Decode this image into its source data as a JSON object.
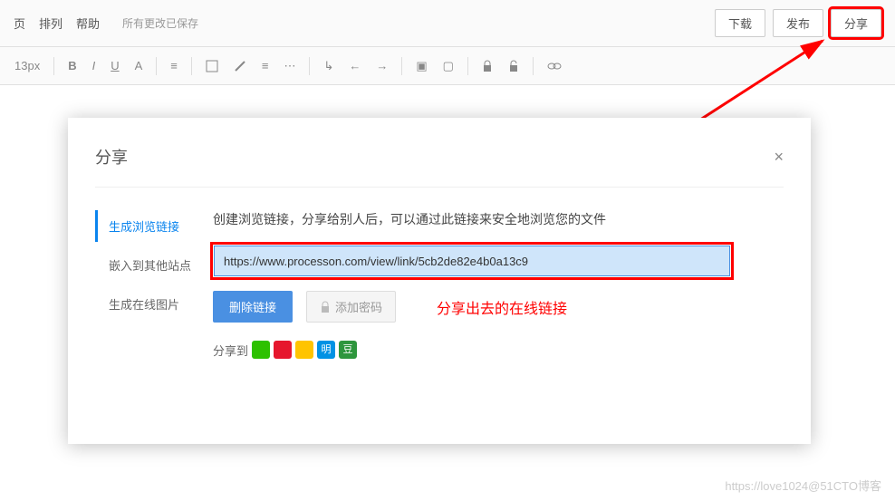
{
  "topbar": {
    "menu1": "页",
    "menu2": "排列",
    "menu3": "帮助",
    "autosave": "所有更改已保存",
    "download": "下载",
    "publish": "发布",
    "share": "分享"
  },
  "toolbar": {
    "fontsize": "13px"
  },
  "modal": {
    "title": "分享",
    "tabs": {
      "generate_link": "生成浏览链接",
      "embed": "嵌入到其他站点",
      "image": "生成在线图片"
    },
    "desc": "创建浏览链接，分享给别人后，可以通过此链接来安全地浏览您的文件",
    "link_value": "https://www.processon.com/view/link/5cb2de82e4b0a13c9",
    "delete_link": "删除链接",
    "add_password": "添加密码",
    "share_to_label": "分享到",
    "ming": "明",
    "dou": "豆"
  },
  "annotation": "分享出去的在线链接",
  "watermark": "https://love1024@51CTO博客"
}
